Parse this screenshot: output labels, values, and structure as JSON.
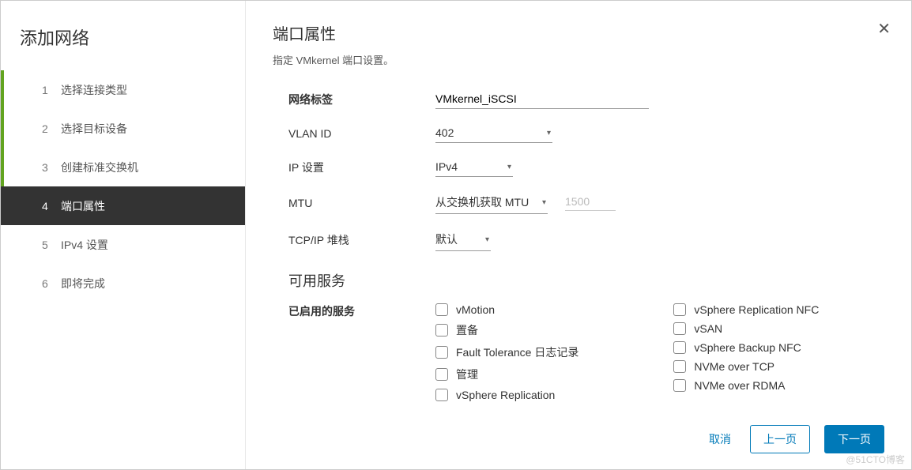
{
  "wizard_title": "添加网络",
  "steps": [
    {
      "num": "1",
      "label": "选择连接类型",
      "state": "done"
    },
    {
      "num": "2",
      "label": "选择目标设备",
      "state": "done"
    },
    {
      "num": "3",
      "label": "创建标准交换机",
      "state": "done"
    },
    {
      "num": "4",
      "label": "端口属性",
      "state": "current"
    },
    {
      "num": "5",
      "label": "IPv4 设置",
      "state": ""
    },
    {
      "num": "6",
      "label": "即将完成",
      "state": ""
    }
  ],
  "page": {
    "title": "端口属性",
    "subtitle": "指定 VMkernel 端口设置。"
  },
  "form": {
    "net_label": {
      "label": "网络标签",
      "value": "VMkernel_iSCSI"
    },
    "vlan_id": {
      "label": "VLAN ID",
      "value": "402"
    },
    "ip_set": {
      "label": "IP 设置",
      "value": "IPv4"
    },
    "mtu": {
      "label": "MTU",
      "value": "从交换机获取 MTU",
      "placeholder": "1500"
    },
    "tcpip": {
      "label": "TCP/IP 堆栈",
      "value": "默认"
    }
  },
  "services": {
    "section_title": "可用服务",
    "label": "已启用的服务",
    "col1": [
      "vMotion",
      "置备",
      "Fault Tolerance 日志记录",
      "管理",
      "vSphere Replication"
    ],
    "col2": [
      "vSphere Replication NFC",
      "vSAN",
      "vSphere Backup NFC",
      "NVMe over TCP",
      "NVMe over RDMA"
    ]
  },
  "footer": {
    "cancel": "取消",
    "back": "上一页",
    "next": "下一页"
  },
  "watermark": "@51CTO博客"
}
